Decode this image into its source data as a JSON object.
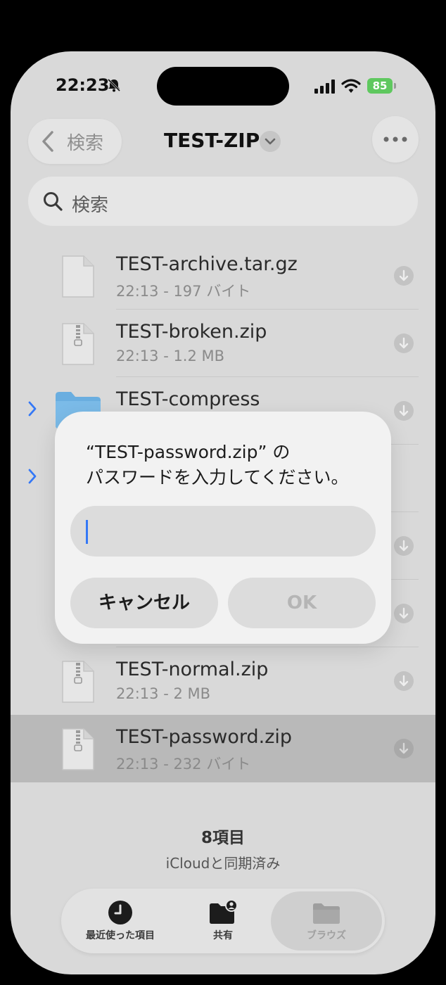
{
  "status_bar": {
    "time": "22:23",
    "battery": "85"
  },
  "nav": {
    "back_label": "検索",
    "title": "TEST-ZIP"
  },
  "search": {
    "placeholder": "検索"
  },
  "files": [
    {
      "name": "TEST-archive.tar.gz",
      "meta": "22:13 - 197 バイト",
      "icon_label": "GZ",
      "kind": "file"
    },
    {
      "name": "TEST-broken.zip",
      "meta": "22:13 - 1.2 MB",
      "icon_label": "ZIP",
      "kind": "zip"
    },
    {
      "name": "TEST-compress",
      "meta": "",
      "icon_label": "",
      "kind": "folder"
    },
    {
      "name": "",
      "meta": "",
      "icon_label": "",
      "kind": "folder"
    },
    {
      "name": "",
      "meta": "",
      "icon_label": "",
      "kind": "zip"
    },
    {
      "name": "",
      "meta": "",
      "icon_label": "",
      "kind": "zip"
    },
    {
      "name": "TEST-normal.zip",
      "meta": "22:13 - 2 MB",
      "icon_label": "ZIP",
      "kind": "zip"
    },
    {
      "name": "TEST-password.zip",
      "meta": "22:13 - 232 バイト",
      "icon_label": "ZIP",
      "kind": "zip",
      "selected": true
    }
  ],
  "footer": {
    "count": "8項目",
    "sync": "iCloudと同期済み"
  },
  "tabs": {
    "recents": "最近使った項目",
    "shared": "共有",
    "browse": "ブラウズ"
  },
  "dialog": {
    "message_line1": "“TEST-password.zip” の",
    "message_line2": "パスワードを入力してください。",
    "input_value": "",
    "cancel_label": "キャンセル",
    "ok_label": "OK"
  },
  "colors": {
    "accent": "#3478f6",
    "battery": "#5fc85f",
    "folder": "#6aaee0"
  }
}
